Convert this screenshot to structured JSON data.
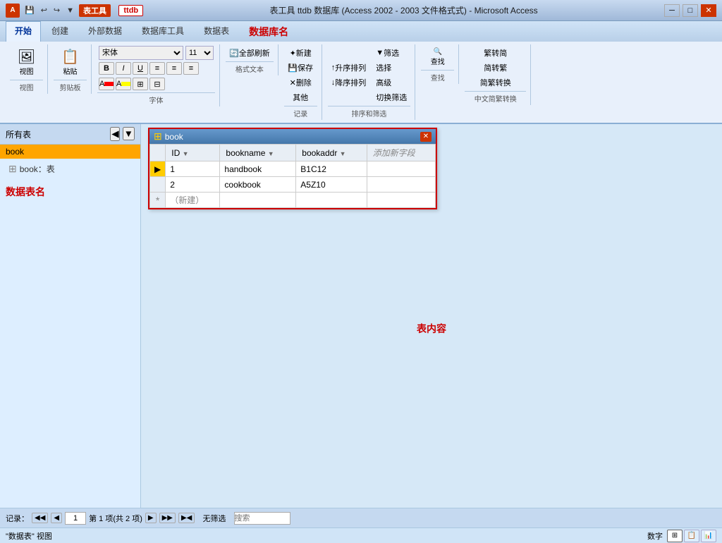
{
  "titleBar": {
    "logo": "A",
    "title": "表工具  ttdb  数据库 (Access 2002 - 2003 文件格式式) - Microsoft Access",
    "dbName": "数据库名",
    "tabActive": "ttdb",
    "tabLabel": "表工具",
    "btnMin": "─",
    "btnMax": "□",
    "btnClose": "✕",
    "qatButtons": [
      "💾",
      "↩",
      "↪",
      "▼"
    ]
  },
  "ribbonTabs": [
    {
      "label": "开始",
      "active": true
    },
    {
      "label": "创建"
    },
    {
      "label": "外部数据"
    },
    {
      "label": "数据库工具"
    },
    {
      "label": "数据表"
    },
    {
      "label": "数据库名",
      "highlighted": true
    }
  ],
  "ribbonGroups": {
    "views": {
      "label": "视图",
      "btn": "视图"
    },
    "clipboard": {
      "label": "剪贴板",
      "paste": "粘贴"
    },
    "font": {
      "label": "字体",
      "fontName": "宋体",
      "fontSize": "11",
      "bold": "B",
      "italic": "I",
      "underline": "U",
      "alignLeft": "≡",
      "alignCenter": "≡",
      "alignRight": "≡",
      "indent1": "≡",
      "indent2": "≡",
      "indent3": "≡",
      "fontColor": "A",
      "bgColor": "A",
      "gridH": "⊞",
      "gridV": "⊟"
    },
    "formatText": {
      "label": "格式文本"
    },
    "records": {
      "label": "记录",
      "new": "新建",
      "save": "保存",
      "delete": "删除",
      "refresh": "全部刷新",
      "more": "其他"
    },
    "sortFilter": {
      "label": "排序和筛选",
      "ascending": "升序排列",
      "descending": "降序排列",
      "filter": "筛选",
      "select": "选择",
      "advanced": "高级",
      "toggle": "切换筛选"
    },
    "find": {
      "label": "查找",
      "find": "查找"
    },
    "chineseConvert": {
      "label": "中文简繁转换",
      "traditional": "繁转简",
      "simplified": "简转繁",
      "convert": "简繁转换"
    }
  },
  "sidebar": {
    "header": "所有表",
    "navBtns": [
      "◀",
      "▼"
    ],
    "activeItem": "book",
    "treeItems": [
      {
        "label": "book：表",
        "icon": "⊞"
      }
    ],
    "label": "数据表名"
  },
  "tableWindow": {
    "title": "book",
    "icon": "⊞",
    "columns": [
      {
        "name": "ID",
        "hasDropdown": true
      },
      {
        "name": "bookname",
        "hasDropdown": true
      },
      {
        "name": "bookaddr",
        "hasDropdown": true
      },
      {
        "name": "添加新字段",
        "isAdd": true
      }
    ],
    "rows": [
      {
        "selector": "▶",
        "id": "1",
        "bookname": "handbook",
        "bookaddr": "B1C12"
      },
      {
        "selector": "",
        "id": "2",
        "bookname": "cookbook",
        "bookaddr": "A5Z10"
      }
    ],
    "newRow": {
      "selector": "*",
      "label": "（新建）"
    }
  },
  "contentLabel": "表内容",
  "statusBar": {
    "recordLabel": "记录：",
    "navFirst": "◀◀",
    "navPrev": "◀",
    "currentRecord": "1",
    "navNext": "▶",
    "navLast": "▶▶",
    "navNew": "▶◀",
    "totalLabel": "第 1 项(共 2 项)",
    "filterLabel": "无筛选",
    "searchPlaceholder": "搜索"
  },
  "bottomBar": {
    "viewLabel": "\"数据表\" 视图",
    "numLabel": "数字",
    "viewBtns": [
      "⊞",
      "📋",
      "⊟"
    ]
  }
}
